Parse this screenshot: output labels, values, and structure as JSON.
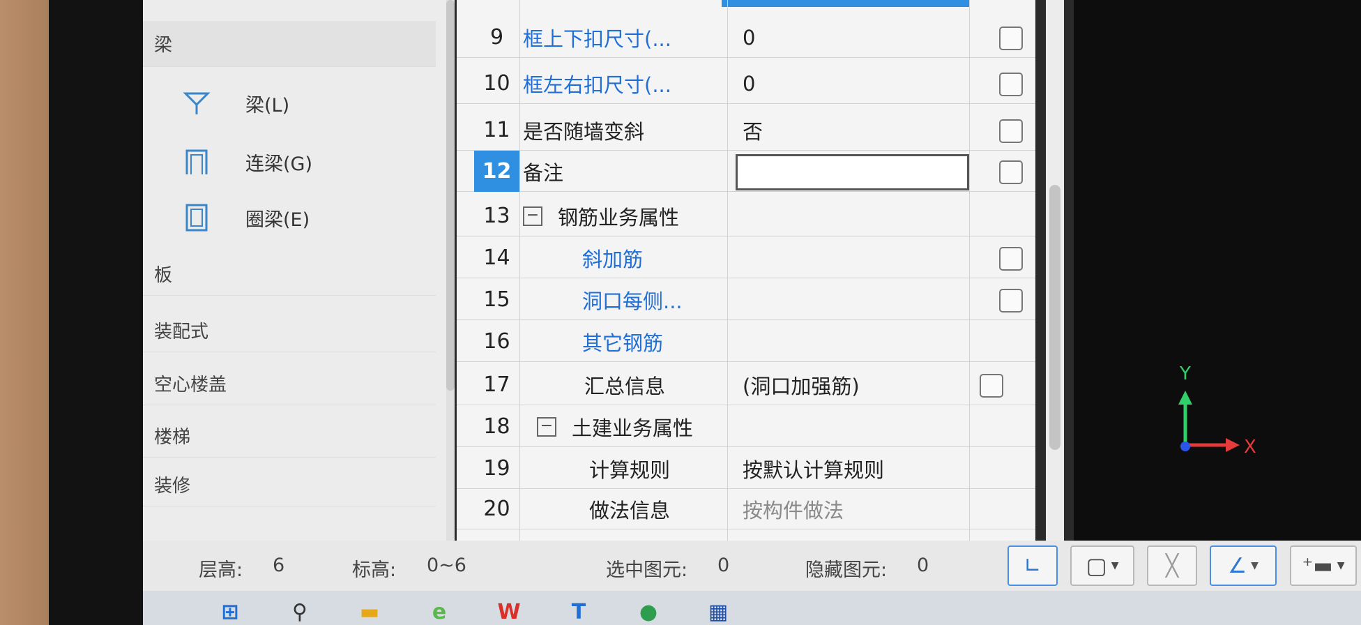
{
  "left_panel": {
    "categories": [
      "梁",
      "板",
      "装配式",
      "空心楼盖",
      "楼梯",
      "装修"
    ],
    "sub_items": [
      {
        "label": "梁(L)",
        "icon": "beam-icon"
      },
      {
        "label": "连梁(G)",
        "icon": "coupling-beam-icon"
      },
      {
        "label": "圈梁(E)",
        "icon": "ring-beam-icon"
      }
    ]
  },
  "property_grid": {
    "selected_row": "12",
    "rows": [
      {
        "num": "9",
        "name": "框上下扣尺寸(...",
        "value": "0",
        "checkbox": true
      },
      {
        "num": "10",
        "name": "框左右扣尺寸(...",
        "value": "0",
        "checkbox": true
      },
      {
        "num": "11",
        "name": "是否随墙变斜",
        "value": "否",
        "checkbox": true
      },
      {
        "num": "12",
        "name": "备注",
        "value": "",
        "checkbox": true
      },
      {
        "num": "13",
        "name": "钢筋业务属性",
        "value": "",
        "checkbox": false,
        "group": "−"
      },
      {
        "num": "14",
        "name": "斜加筋",
        "value": "",
        "checkbox": true
      },
      {
        "num": "15",
        "name": "洞口每侧...",
        "value": "",
        "checkbox": true
      },
      {
        "num": "16",
        "name": "其它钢筋",
        "value": "",
        "checkbox": false
      },
      {
        "num": "17",
        "name": "汇总信息",
        "value": "(洞口加强筋)",
        "checkbox": true
      },
      {
        "num": "18",
        "name": "土建业务属性",
        "value": "",
        "checkbox": false,
        "group": "−"
      },
      {
        "num": "19",
        "name": "计算规则",
        "value": "按默认计算规则",
        "checkbox": false
      },
      {
        "num": "20",
        "name": "做法信息",
        "value": "按构件做法",
        "checkbox": false
      }
    ]
  },
  "viewport": {
    "axis_y": "Y",
    "axis_x": "X"
  },
  "statusbar": {
    "floor_height_label": "层高:",
    "floor_height_value": "6",
    "elevation_label": "标高:",
    "elevation_value": "0~6",
    "selected_label": "选中图元:",
    "selected_value": "0",
    "hidden_label": "隐藏图元:",
    "hidden_value": "0"
  },
  "colors": {
    "accent": "#2f8fe0",
    "link_blue": "#1f6fd6",
    "viewport_bg": "#0d0d0d"
  }
}
